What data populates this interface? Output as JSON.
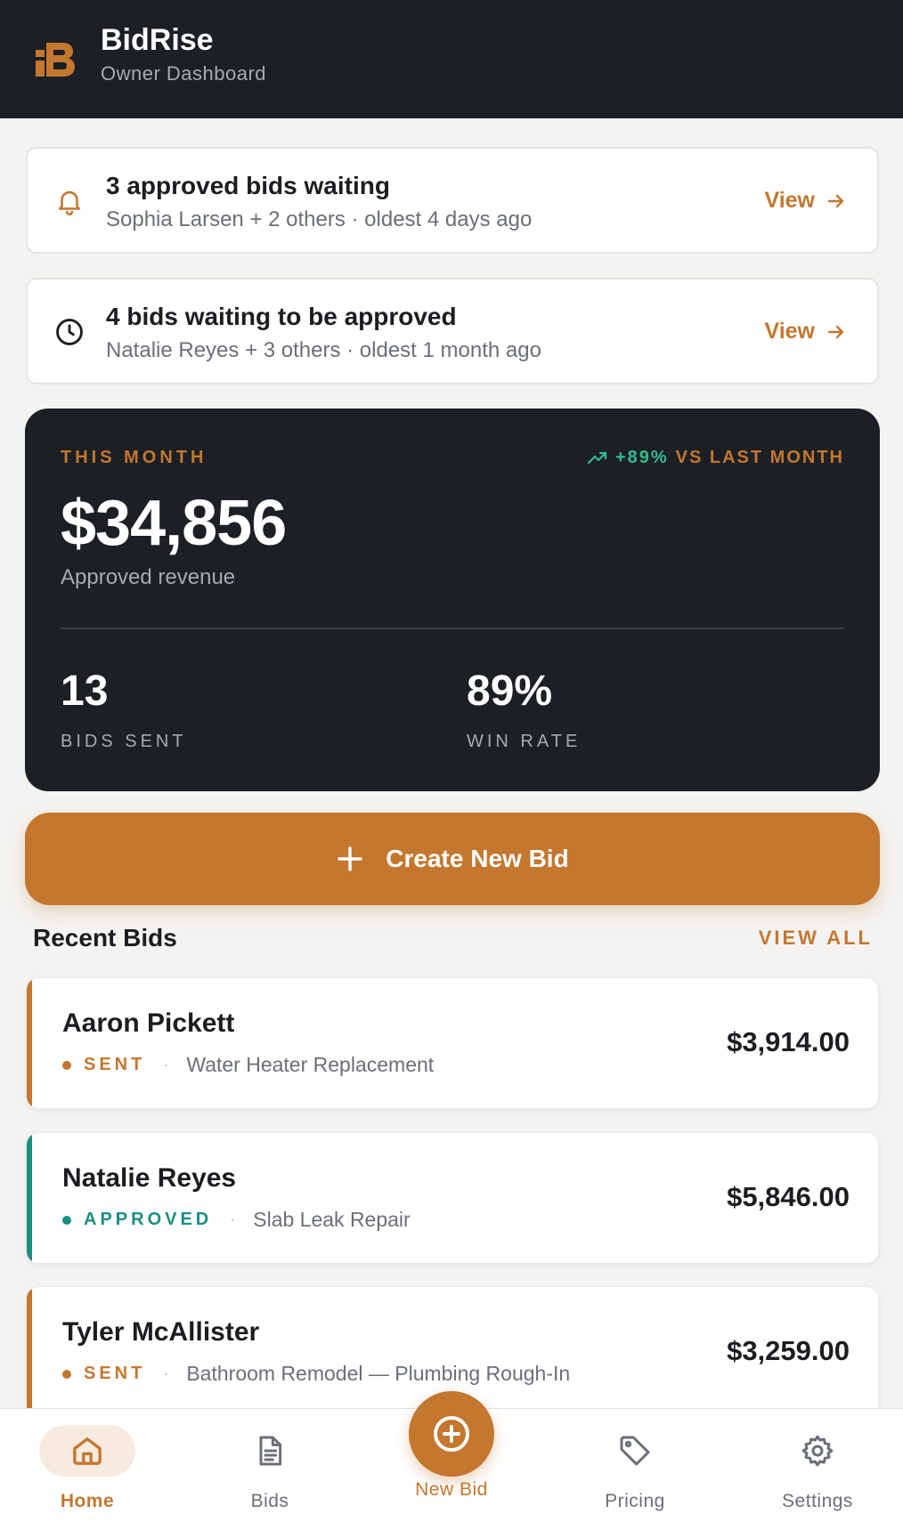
{
  "header": {
    "app_name": "BidRise",
    "subtitle": "Owner Dashboard",
    "logo_icon": "bidrise-logo-icon"
  },
  "alerts": [
    {
      "icon": "bell-icon",
      "title": "3 approved bids waiting",
      "description": "Sophia Larsen + 2 others · oldest 4 days ago",
      "action": "View"
    },
    {
      "icon": "clock-icon",
      "title": "4 bids waiting to be approved",
      "description": "Natalie Reyes + 3 others · oldest 1 month ago",
      "action": "View"
    }
  ],
  "stats": {
    "period_label": "THIS MONTH",
    "trend_value": "+89%",
    "trend_text": "VS LAST MONTH",
    "revenue": "$34,856",
    "revenue_label": "Approved revenue",
    "bids_sent": "13",
    "bids_sent_label": "BIDS SENT",
    "win_rate": "89%",
    "win_rate_label": "WIN RATE"
  },
  "cta": {
    "label": "Create New Bid"
  },
  "recent": {
    "title": "Recent Bids",
    "view_all": "VIEW ALL",
    "bids": [
      {
        "name": "Aaron Pickett",
        "status": "SENT",
        "service": "Water Heater Replacement",
        "amount": "$3,914.00",
        "status_color": "#c4772f"
      },
      {
        "name": "Natalie Reyes",
        "status": "APPROVED",
        "service": "Slab Leak Repair",
        "amount": "$5,846.00",
        "status_color": "#1a8f7f"
      },
      {
        "name": "Tyler McAllister",
        "status": "SENT",
        "service": "Bathroom Remodel — Plumbing Rough-In",
        "amount": "$3,259.00",
        "status_color": "#c4772f"
      }
    ]
  },
  "tabbar": {
    "home": "Home",
    "bids": "Bids",
    "new_bid": "New Bid",
    "pricing": "Pricing",
    "settings": "Settings"
  },
  "colors": {
    "accent": "#c4772f",
    "dark": "#1c1f24",
    "approved": "#1a8f7f",
    "trend_up": "#2fbf8c"
  }
}
